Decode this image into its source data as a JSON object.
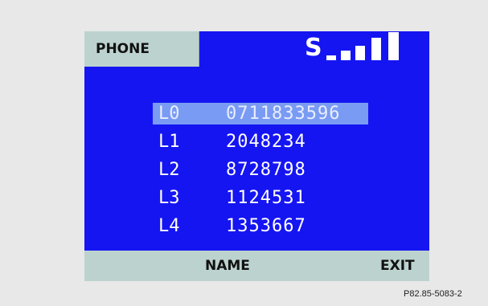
{
  "header": {
    "tab_label": "PHONE",
    "signal_letter": "S",
    "signal_level": "5/5"
  },
  "lines": [
    {
      "id": "L0",
      "number": "0711833596",
      "selected": true
    },
    {
      "id": "L1",
      "number": "2048234",
      "selected": false
    },
    {
      "id": "L2",
      "number": "8728798",
      "selected": false
    },
    {
      "id": "L3",
      "number": "1124531",
      "selected": false
    },
    {
      "id": "L4",
      "number": "1353667",
      "selected": false
    }
  ],
  "softkeys": {
    "name_label": "NAME",
    "exit_label": "EXIT"
  },
  "figure_ref": "P82.85-5083-2",
  "colors": {
    "screen_blue": "#1515f2",
    "softkey_bar": "#bcd2cf",
    "selection": "#7a9bf3",
    "background": "#e8e8e8"
  }
}
